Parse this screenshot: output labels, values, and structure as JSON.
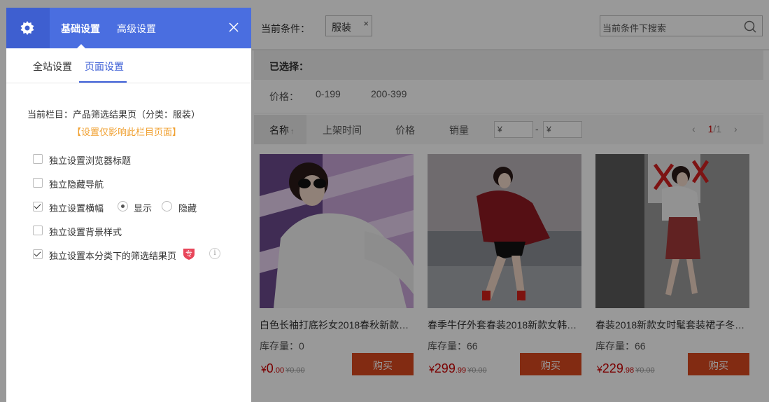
{
  "background": {
    "condition_label": "当前条件：",
    "condition_tag": "服装",
    "tag_close": "×",
    "search_placeholder": "当前条件下搜索",
    "selected_label": "已选择：",
    "price_label": "价格：",
    "price_options": [
      "0-199",
      "200-399"
    ],
    "sort": {
      "items": [
        "名称",
        "上架时间",
        "价格",
        "销量"
      ],
      "active_arrow": "↑",
      "price_min": "¥",
      "price_max": "¥",
      "dash": "-",
      "pager_prev": "‹",
      "pager_next": "›",
      "pager_current": "1",
      "pager_total": "/1"
    },
    "products": [
      {
        "name": "白色长袖打底衫女2018春秋新款…",
        "stock": "库存量：0",
        "price_sym": "¥",
        "price_int": "0",
        "price_dec": ".00",
        "price_old": "¥0.00",
        "buy": "购买"
      },
      {
        "name": "春季牛仔外套春装2018新款女韩…",
        "stock": "库存量：66",
        "price_sym": "¥",
        "price_int": "299",
        "price_dec": ".99",
        "price_old": "¥0.00",
        "buy": "购买"
      },
      {
        "name": "春装2018新款女时髦套装裙子冬…",
        "stock": "库存量：66",
        "price_sym": "¥",
        "price_int": "229",
        "price_dec": ".98",
        "price_old": "¥0.00",
        "buy": "购买"
      }
    ]
  },
  "panel": {
    "tabs": [
      "基础设置",
      "高级设置"
    ],
    "subtabs": [
      "全站设置",
      "页面设置"
    ],
    "current_column": "当前栏目：产品筛选结果页（分类：服装）",
    "note": "【设置仅影响此栏目页面】",
    "options": [
      {
        "label": "独立设置浏览器标题",
        "checked": false
      },
      {
        "label": "独立隐藏导航",
        "checked": false
      },
      {
        "label": "独立设置横幅",
        "checked": true
      },
      {
        "label": "独立设置背景样式",
        "checked": false
      },
      {
        "label": "独立设置本分类下的筛选结果页",
        "checked": true
      }
    ],
    "banner_radio": {
      "show": "显示",
      "hide": "隐藏",
      "selected": "显示"
    },
    "pro_badge": "专",
    "info": "i"
  },
  "colors": {
    "accent": "#4a6ee0",
    "buy": "#d9481f",
    "note": "#f0a030",
    "price": "#cc0000"
  }
}
